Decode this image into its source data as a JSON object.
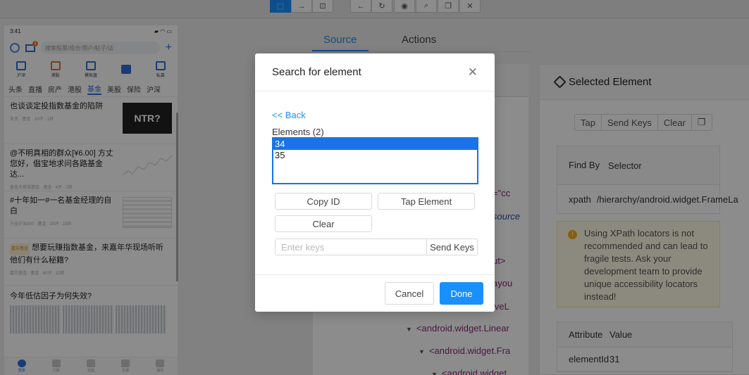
{
  "toolbar": {
    "buttons": [
      {
        "icon": "select-icon",
        "glyph": "⬚"
      },
      {
        "icon": "swipe-icon",
        "glyph": "→"
      },
      {
        "icon": "tap-icon",
        "glyph": "⊡"
      },
      {
        "icon": "back-icon",
        "glyph": "←"
      },
      {
        "icon": "refresh-icon",
        "glyph": "↻"
      },
      {
        "icon": "eye-icon",
        "glyph": "◉"
      },
      {
        "icon": "search-icon",
        "glyph": "⌕"
      },
      {
        "icon": "copy-icon",
        "glyph": "❐"
      },
      {
        "icon": "close-icon",
        "glyph": "✕"
      }
    ]
  },
  "phone": {
    "time": "3:41",
    "mail_badge": "1",
    "search_placeholder": "搜索股票/组合/用户/帖子/话",
    "quick_items": [
      "沪深",
      "港股",
      "模拟盘",
      "",
      "私募"
    ],
    "tabs": [
      "头条",
      "直播",
      "房产",
      "港股",
      "基金",
      "美股",
      "保险",
      "沪深"
    ],
    "selected_tab": "基金",
    "news": [
      {
        "title": "也谈谈定投指数基金的陷阱",
        "meta": "天天 · 基金 · 10评 · 1转"
      },
      {
        "title": "@不明真相的群众[¥6.00] 方丈您好，倡宝地求问各路基金达...",
        "meta": "基金大佬说基金 · 基金 · 4评 · 1转"
      },
      {
        "title": "#十年如一#一名基金经理的自白",
        "meta": "兴全沪深300 · 基金 · 20评 · 23转"
      },
      {
        "title": "想要玩赚指数基金，来嘉年华现场听听他们有什么秘籍?",
        "meta": "嘉实基金 · 基金 · 60评 · 12转",
        "tag": "嘉实基金"
      }
    ],
    "last_title": "今年低估因子为何失效?",
    "thumb_text": "NTR?",
    "bottom_nav": [
      "雪球",
      "行情",
      "自选",
      "交易",
      "我的"
    ]
  },
  "main_tabs": [
    "Source",
    "Actions"
  ],
  "source_tree": {
    "lines": [
      {
        "text": "=\"cc",
        "arrow": false,
        "style": "plain"
      },
      {
        "text": "source",
        "arrow": false,
        "style": "blue"
      },
      {
        "text": "ut>",
        "arrow": false,
        "style": "plain"
      },
      {
        "text": "ayou",
        "arrow": false,
        "style": "plain"
      },
      {
        "text": "iveL",
        "arrow": false,
        "style": "plain"
      },
      {
        "text": "<android.widget.Linear",
        "arrow": true,
        "style": "plain"
      },
      {
        "text": "<android.widget.Fra",
        "arrow": true,
        "style": "plain"
      },
      {
        "text": "<android.widget.",
        "arrow": true,
        "style": "plain"
      }
    ]
  },
  "selected_element": {
    "title": "Selected Element",
    "buttons": [
      "Tap",
      "Send Keys",
      "Clear",
      "❐"
    ],
    "find_by_header": "Find By",
    "selector_header": "Selector",
    "find_by": "xpath",
    "selector": "/hierarchy/android.widget.FrameLa",
    "warning": "Using XPath locators is not recommended and can lead to fragile tests. Ask your development team to provide unique accessibility locators instead!",
    "attr_header": "Attribute",
    "value_header": "Value",
    "attributes": [
      {
        "name": "elementId",
        "value": "31"
      }
    ]
  },
  "modal": {
    "title": "Search for element",
    "back": "<< Back",
    "elements_label": "Elements (2)",
    "elements": [
      "34",
      "35"
    ],
    "selected_index": 0,
    "copy_id": "Copy ID",
    "tap_element": "Tap Element",
    "clear": "Clear",
    "keys_placeholder": "Enter keys",
    "send_keys": "Send Keys",
    "cancel": "Cancel",
    "done": "Done"
  }
}
